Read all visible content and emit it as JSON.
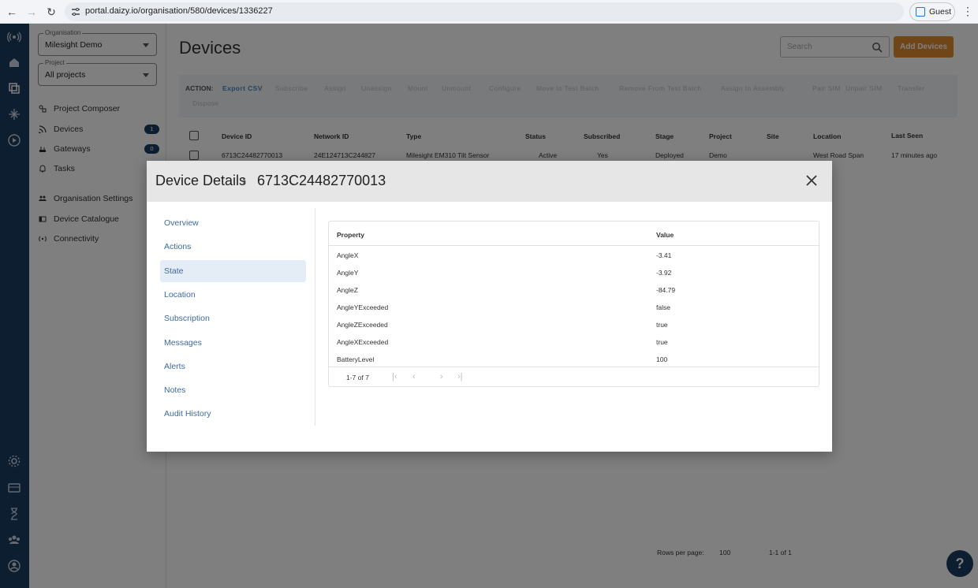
{
  "browser": {
    "url": "portal.daizy.io/organisation/580/devices/1336227",
    "profile": "Guest"
  },
  "sidebar": {
    "organisation": {
      "label": "Organisation",
      "value": "Milesight Demo"
    },
    "project": {
      "label": "Project",
      "value": "All projects"
    },
    "items": [
      {
        "label": "Project Composer",
        "icon": "composer-icon"
      },
      {
        "label": "Devices",
        "icon": "devices-icon",
        "badge": "1"
      },
      {
        "label": "Gateways",
        "icon": "gateway-icon",
        "badge": "0"
      },
      {
        "label": "Tasks",
        "icon": "tasks-icon"
      },
      {
        "label": "Organisation Settings",
        "icon": "people-icon"
      },
      {
        "label": "Device Catalogue",
        "icon": "catalogue-icon"
      },
      {
        "label": "Connectivity",
        "icon": "connectivity-icon"
      }
    ]
  },
  "main": {
    "title": "Devices",
    "search_placeholder": "Search",
    "add_button": "Add Devices",
    "action_label": "ACTION:",
    "actions": [
      "Export CSV",
      "Subscribe",
      "Assign",
      "Unassign",
      "Mount",
      "Unmount",
      "Configure",
      "Move to Test Batch",
      "Remove From Test Batch",
      "Assign to Assembly",
      "Pair SIM",
      "Unpair SIM",
      "Transfer",
      "Dispose"
    ],
    "columns": [
      "Device ID",
      "Network ID",
      "Type",
      "Status",
      "Subscribed",
      "Stage",
      "Project",
      "Site",
      "Location",
      "Last Seen"
    ],
    "row": {
      "device_id": "6713C24482770013",
      "network_id": "24E124713C244827",
      "type": "Milesight EM310 Tilt Sensor",
      "status": "Active",
      "subscribed": "Yes",
      "stage": "Deployed",
      "project": "Demo",
      "site": "",
      "location": "West Road Span",
      "last_seen": "17 minutes ago"
    },
    "rows_per_page_label": "Rows per page:",
    "rows_per_page": "100",
    "range": "1-1 of 1",
    "help": "?"
  },
  "dialog": {
    "title": "Device Details",
    "separator": "›",
    "device_id": "6713C24482770013",
    "nav": [
      "Overview",
      "Actions",
      "State",
      "Location",
      "Subscription",
      "Messages",
      "Alerts",
      "Notes",
      "Audit History"
    ],
    "active_nav": "State",
    "table": {
      "headers": {
        "property": "Property",
        "value": "Value"
      },
      "rows": [
        {
          "property": "AngleX",
          "value": "-3.41"
        },
        {
          "property": "AngleY",
          "value": "-3.92"
        },
        {
          "property": "AngleZ",
          "value": "-84.79"
        },
        {
          "property": "AngleYExceeded",
          "value": "false"
        },
        {
          "property": "AngleZExceeded",
          "value": "true"
        },
        {
          "property": "AngleXExceeded",
          "value": "true"
        },
        {
          "property": "BatteryLevel",
          "value": "100"
        }
      ],
      "pagination": "1-7 of 7"
    }
  }
}
